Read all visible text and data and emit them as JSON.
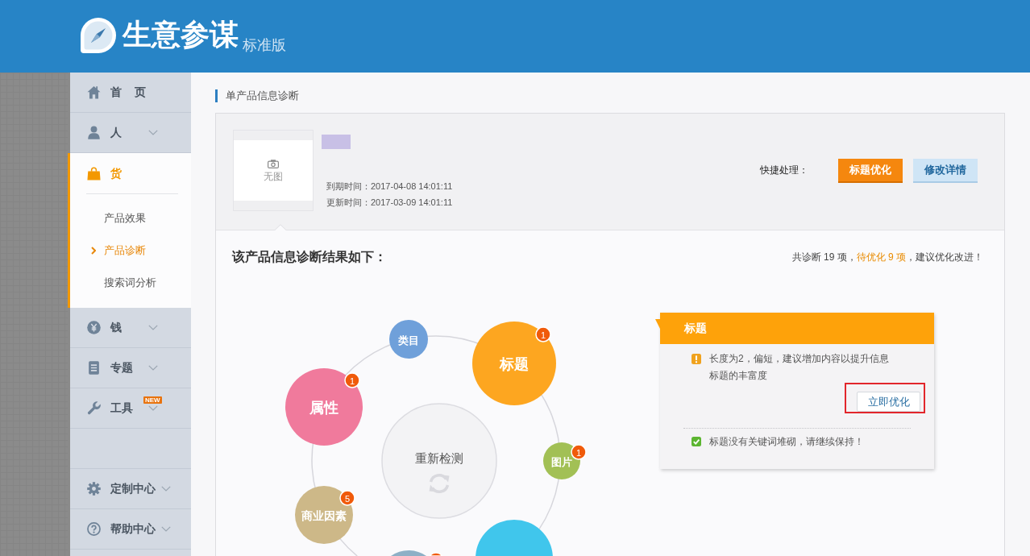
{
  "header": {
    "logo_text": "生意参谋",
    "edition": "标准版"
  },
  "sidebar": {
    "items": [
      {
        "label": "首 页",
        "kind": "link",
        "selected": false
      },
      {
        "label": "人",
        "kind": "menu",
        "selected": false,
        "expanded": false
      },
      {
        "label": "货",
        "kind": "menu",
        "selected": true,
        "expanded": true,
        "children": [
          {
            "label": "产品效果",
            "selected": false
          },
          {
            "label": "产品诊断",
            "selected": true
          },
          {
            "label": "搜索词分析",
            "selected": false
          }
        ]
      },
      {
        "label": "钱",
        "kind": "menu",
        "selected": false,
        "expanded": false
      },
      {
        "label": "专题",
        "kind": "menu",
        "selected": false,
        "expanded": false
      },
      {
        "label": "工具",
        "kind": "menu",
        "selected": false,
        "expanded": false,
        "badge": "NEW"
      }
    ],
    "footer_items": [
      {
        "label": "定制中心",
        "kind": "menu",
        "selected": false,
        "expanded": false
      },
      {
        "label": "帮助中心",
        "kind": "menu",
        "selected": false,
        "expanded": false
      }
    ]
  },
  "main": {
    "section_title": "单产品信息诊断",
    "product": {
      "image_placeholder": "无图",
      "dates": [
        "到期时间：2017-04-08 14:01:11",
        "更新时间：2017-03-09 14:01:11"
      ]
    },
    "quick_actions": {
      "label": "快捷处理：",
      "buttons": [
        {
          "label": "标题优化",
          "kind": "primary"
        },
        {
          "label": "修改详情",
          "kind": "secondary"
        }
      ]
    },
    "result": {
      "heading": "该产品信息诊断结果如下：",
      "summary": {
        "total": "共诊断 19 项，",
        "pending": "待优化 9 项",
        "advice": "，建议优化改进！"
      }
    },
    "diagram": {
      "center_label": "重新检测",
      "nodes": [
        {
          "label": "类目",
          "color": "#6fa0da",
          "flagged": false
        },
        {
          "label": "标题",
          "color": "#fda620",
          "flagged": true,
          "count": "1"
        },
        {
          "label": "属性",
          "color": "#f07a9c",
          "flagged": true,
          "count": "1"
        },
        {
          "label": "图片",
          "color": "#a2c055",
          "flagged": true,
          "count": "1"
        },
        {
          "label": "商业因素",
          "color": "#cdb888",
          "flagged": true,
          "count": "5"
        },
        {
          "color": "#40c6ec",
          "flagged": false
        },
        {
          "color": "#8eb0c6",
          "flagged": true
        }
      ]
    },
    "detail": {
      "title": "标题",
      "items": [
        {
          "kind": "warning",
          "text": "长度为2，偏短，建议增加内容以提升信息标题的丰富度",
          "action": {
            "label": "立即优化",
            "highlighted": true
          }
        },
        {
          "kind": "ok",
          "text": "标题没有关键词堆砌，请继续保持！"
        }
      ]
    }
  }
}
